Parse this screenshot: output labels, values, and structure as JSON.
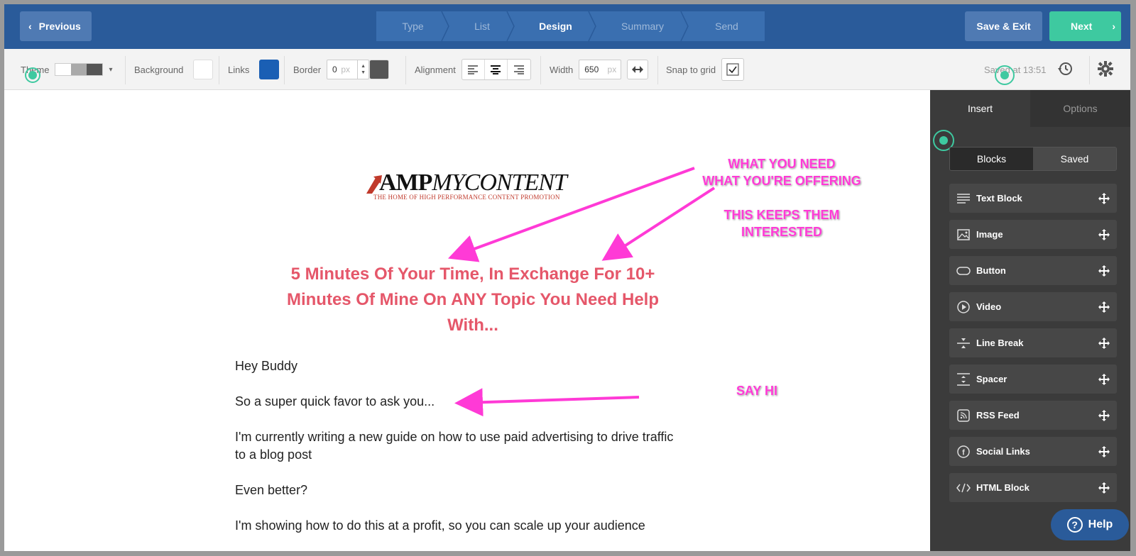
{
  "header": {
    "previous_label": "Previous",
    "steps": [
      {
        "label": "Type",
        "active": false
      },
      {
        "label": "List",
        "active": false
      },
      {
        "label": "Design",
        "active": true
      },
      {
        "label": "Summary",
        "active": false
      },
      {
        "label": "Send",
        "active": false
      }
    ],
    "save_exit_label": "Save & Exit",
    "next_label": "Next"
  },
  "toolbar": {
    "theme_label": "Theme",
    "background_label": "Background",
    "links_label": "Links",
    "border_label": "Border",
    "border_value": "0",
    "border_unit": "px",
    "alignment_label": "Alignment",
    "width_label": "Width",
    "width_value": "650",
    "width_unit": "px",
    "snap_label": "Snap to grid",
    "saved_text": "Saved at 13:51",
    "colors": {
      "background": "#ffffff",
      "links": "#1a5fb4",
      "border": "#555555"
    }
  },
  "email": {
    "logo_brand_bold": "AMP",
    "logo_brand_light": "MYCONTENT",
    "logo_tagline": "THE HOME OF HIGH PERFORMANCE CONTENT PROMOTION",
    "headline": "5 Minutes Of Your Time, In Exchange For 10+ Minutes Of Mine On ANY Topic You Need Help With...",
    "paragraphs": [
      "Hey Buddy",
      "So a super quick favor to ask you...",
      "I'm currently writing a new guide on how to use paid advertising to drive traffic to a blog post",
      "Even better?",
      "I'm showing how to do this at a profit, so you can scale up your audience"
    ]
  },
  "annotations": {
    "line1": "WHAT YOU NEED",
    "line2": "WHAT YOU'RE OFFERING",
    "line3": "THIS KEEPS THEM",
    "line4": "INTERESTED",
    "say_hi": "SAY HI",
    "color": "#ff3ad6"
  },
  "panel": {
    "tabs": [
      {
        "label": "Insert"
      },
      {
        "label": "Options"
      }
    ],
    "subtabs": [
      {
        "label": "Blocks"
      },
      {
        "label": "Saved"
      }
    ],
    "blocks": [
      {
        "label": "Text Block",
        "icon": "text-lines-icon"
      },
      {
        "label": "Image",
        "icon": "image-icon"
      },
      {
        "label": "Button",
        "icon": "button-pill-icon"
      },
      {
        "label": "Video",
        "icon": "play-icon"
      },
      {
        "label": "Line Break",
        "icon": "line-break-icon"
      },
      {
        "label": "Spacer",
        "icon": "spacer-icon"
      },
      {
        "label": "RSS Feed",
        "icon": "rss-icon"
      },
      {
        "label": "Social Links",
        "icon": "facebook-icon"
      },
      {
        "label": "HTML Block",
        "icon": "code-icon"
      }
    ]
  },
  "help_label": "Help",
  "accent_colors": {
    "primary": "#2a5b9a",
    "next": "#3ec9a0",
    "headline": "#e5576a"
  }
}
